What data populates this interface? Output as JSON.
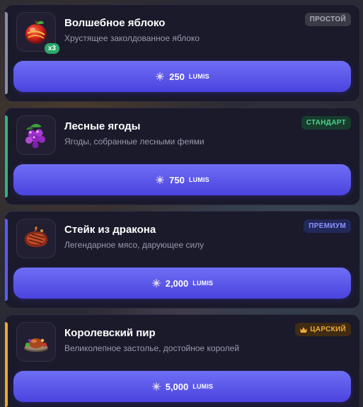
{
  "items": [
    {
      "title": "Волшебное яблоко",
      "description": "Хрустящее заколдованное яблоко",
      "tier": "ПРОСТОЙ",
      "tier_colors": {
        "bg": "#3a3a45",
        "fg": "#a9a9b6"
      },
      "accent": "#8d8da0",
      "quantity": "x3",
      "price": "250",
      "currency": "LUMIS",
      "icon": "magic-apple-icon"
    },
    {
      "title": "Лесные ягоды",
      "description": "Ягоды, собранные лесными феями",
      "tier": "СТАНДАРТ",
      "tier_colors": {
        "bg": "#173d2e",
        "fg": "#4fd08c"
      },
      "accent": "#33b474",
      "price": "750",
      "currency": "LUMIS",
      "icon": "forest-berries-icon"
    },
    {
      "title": "Стейк из дракона",
      "description": "Легендарное мясо, дарующее силу",
      "tier": "ПРЕМИУМ",
      "tier_colors": {
        "bg": "#23285a",
        "fg": "#8a94ff"
      },
      "accent": "#5b5cf0",
      "price": "2,000",
      "currency": "LUMIS",
      "icon": "dragon-steak-icon"
    },
    {
      "title": "Королевский пир",
      "description": "Великолепное застолье, достойное королей",
      "tier": "ЦАРСКИЙ",
      "tier_icon": "crown-icon",
      "tier_colors": {
        "bg": "#3f2c12",
        "fg": "#f0a93b"
      },
      "accent": "#f0a821",
      "price": "5,000",
      "currency": "LUMIS",
      "icon": "royal-feast-icon"
    }
  ]
}
